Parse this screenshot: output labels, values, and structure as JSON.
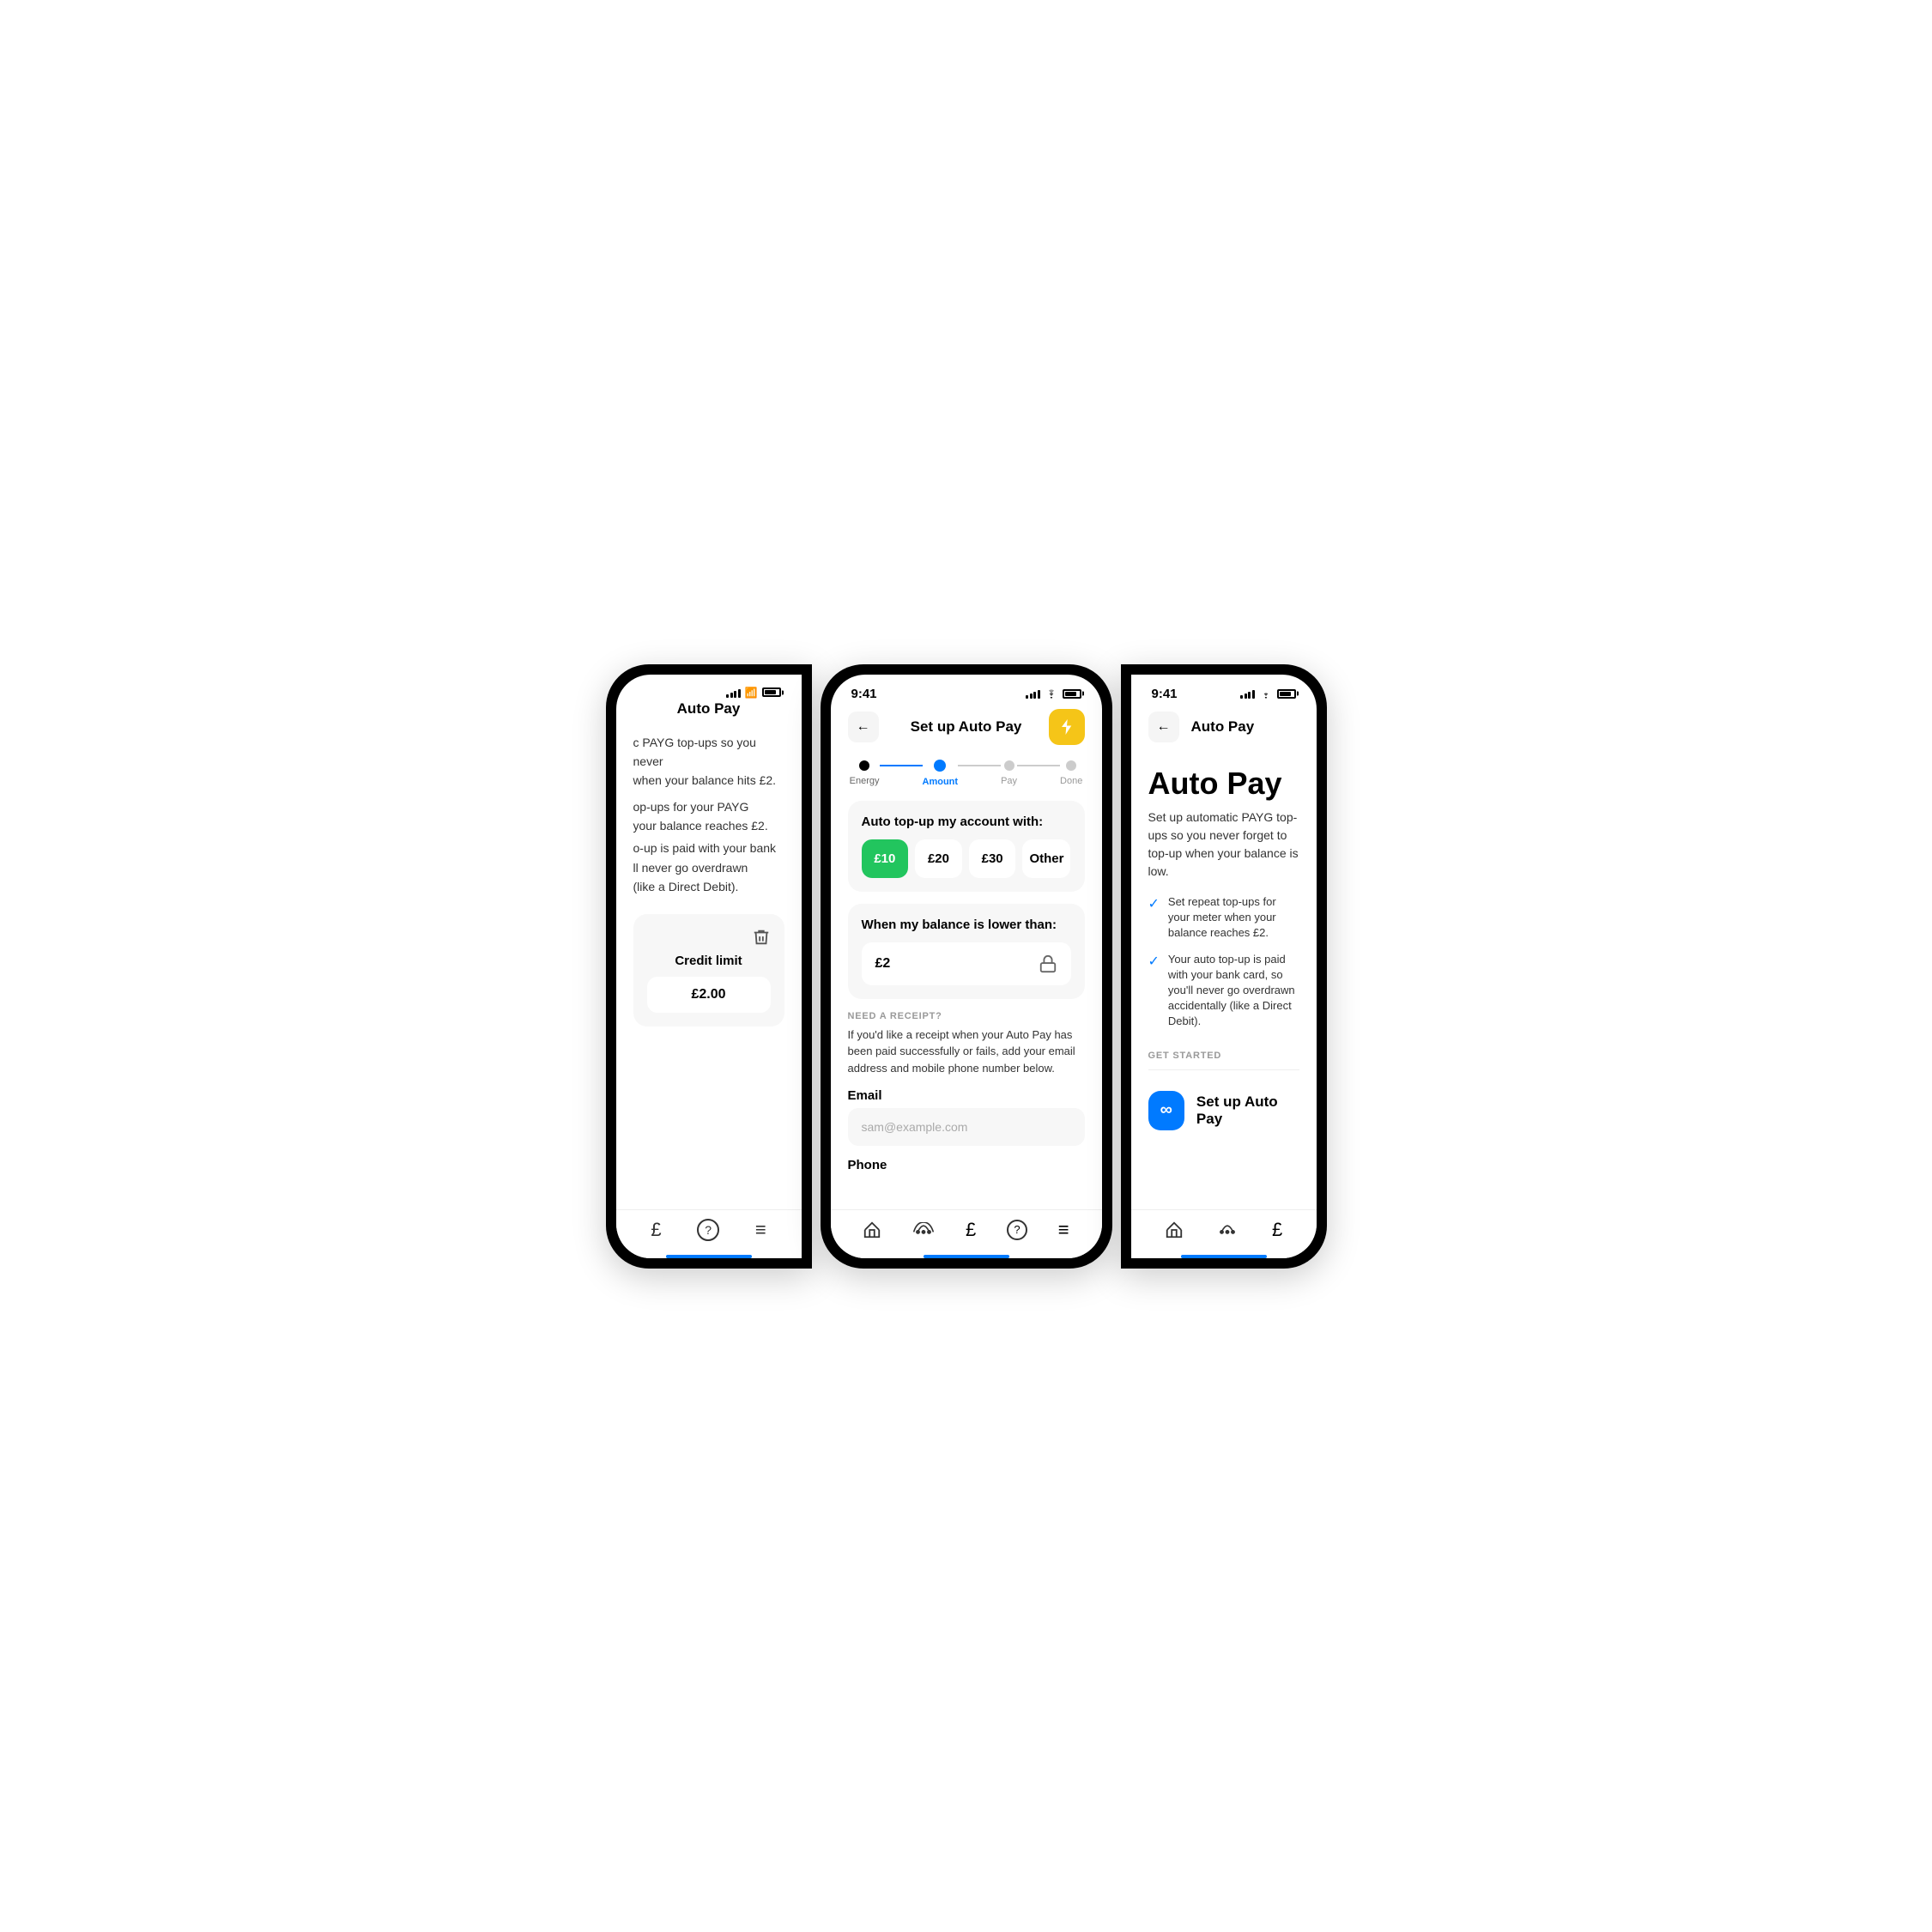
{
  "screens": {
    "left": {
      "title": "Auto Pay",
      "description_line1": "c PAYG top-ups so you never",
      "description_line2": "when your balance hits £2.",
      "description_line3": "op-ups for your PAYG",
      "description_line4": "your balance reaches £2.",
      "description_line5": "o-up is paid with your bank",
      "description_line6": "ll never go overdrawn",
      "description_line7": "(like a Direct Debit).",
      "credit_limit_label": "Credit limit",
      "credit_limit_value": "£2.00",
      "bottom_nav": [
        "£",
        "?",
        "≡"
      ]
    },
    "center": {
      "status_time": "9:41",
      "nav_title": "Set up Auto Pay",
      "stepper": {
        "steps": [
          {
            "label": "Energy",
            "state": "done"
          },
          {
            "label": "Amount",
            "state": "active"
          },
          {
            "label": "Pay",
            "state": "inactive"
          },
          {
            "label": "Done",
            "state": "inactive"
          }
        ]
      },
      "amount_section": {
        "title": "Auto top-up my account with:",
        "options": [
          {
            "value": "£10",
            "selected": true
          },
          {
            "value": "£20",
            "selected": false
          },
          {
            "value": "£30",
            "selected": false
          },
          {
            "value": "Other",
            "selected": false
          }
        ]
      },
      "balance_section": {
        "title": "When my balance is lower than:",
        "value": "£2"
      },
      "receipt_section": {
        "label": "NEED A RECEIPT?",
        "description": "If you'd like a receipt when your Auto Pay has been paid successfully or fails, add your email address and mobile phone number below.",
        "email_label": "Email",
        "email_placeholder": "sam@example.com",
        "phone_label": "Phone"
      },
      "bottom_nav": [
        "home",
        "network",
        "account",
        "help",
        "menu"
      ]
    },
    "right": {
      "status_time": "9:41",
      "nav_title": "Auto Pay",
      "main_title": "Auto Pay",
      "description": "Set up automatic PAYG top-ups so you never forget to top-up when your balance is low.",
      "features": [
        "Set repeat top-ups for your meter when your balance reaches £2.",
        "Your auto top-up is paid with your bank card, so you'll never go overdrawn accidentally (like a Direct Debit)."
      ],
      "get_started_label": "GET STARTED",
      "setup_button_label": "Set up Auto Pay",
      "bottom_nav": [
        "home",
        "network",
        "account"
      ]
    }
  },
  "icons": {
    "back_arrow": "←",
    "lightning": "⚡",
    "trash": "🗑",
    "lock": "🔒",
    "check": "✓",
    "infinity": "∞",
    "home": "⌂",
    "help": "?",
    "menu": "≡",
    "pounds": "£"
  },
  "colors": {
    "green": "#22C55E",
    "blue": "#007AFF",
    "yellow": "#F5C518",
    "gray_bg": "#f7f7f7",
    "white": "#ffffff",
    "black": "#000000",
    "light_gray": "#ccc",
    "text_gray": "#999"
  }
}
